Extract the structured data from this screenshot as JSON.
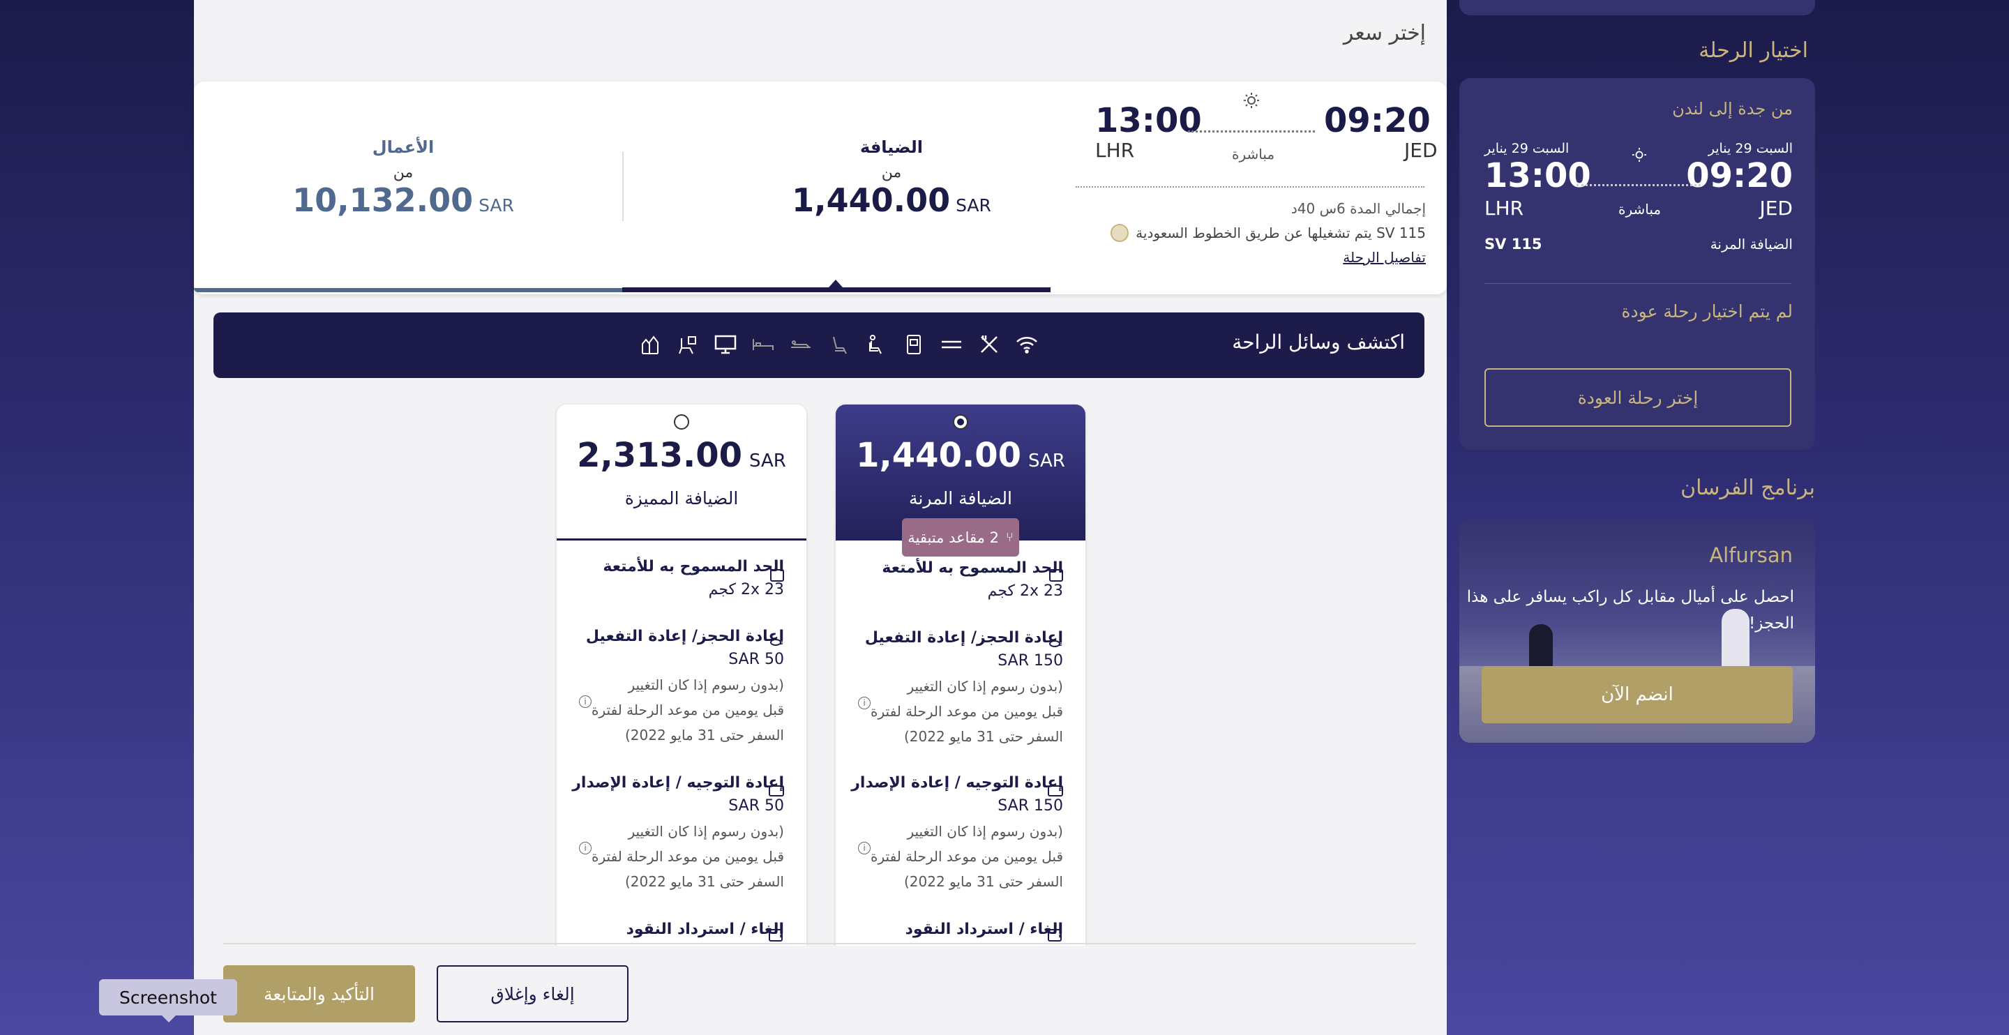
{
  "page": {
    "select_fare_title": "إختر سعر"
  },
  "flight_card": {
    "depart_time": "09:20",
    "arrive_time": "13:00",
    "depart_airport": "JED",
    "arrive_airport": "LHR",
    "stops": "مباشرة",
    "total_duration": "إجمالي المدة 6س 40د",
    "operated_by": "SV 115 يتم تشغيلها عن طريق الخطوط السعودية",
    "details_link": "تفاصيل الرحلة",
    "cabins": [
      {
        "name": "الضيافة",
        "from": "من",
        "price": "1,440.00",
        "currency": "SAR"
      },
      {
        "name": "الأعمال",
        "from": "من",
        "price": "10,132.00",
        "currency": "SAR"
      }
    ]
  },
  "amenities": {
    "title": "اكتشف وسائل الراحة"
  },
  "fares": [
    {
      "price": "1,440.00",
      "currency": "SAR",
      "name": "الضيافة المرنة",
      "selected": true,
      "seats_left": "2 مقاعد متبقية",
      "baggage_title": "الحد المسموح به للأمتعة",
      "baggage_value": "2x 23 كجم",
      "rebook_title": "إعادة الحجز/ إعادة التفعيل",
      "rebook_value": "SAR 150",
      "rebook_note_1": "(بدون رسوم إذا كان التغيير",
      "rebook_note_2": "قبل يومين من موعد الرحلة لفترة",
      "rebook_note_3": "السفر حتى 31 مايو 2022)",
      "reroute_title": "إعادة التوجيه / إعادة الإصدار",
      "reroute_value": "SAR 150",
      "reroute_note_1": "(بدون رسوم إذا كان التغيير",
      "reroute_note_2": "قبل يومين من موعد الرحلة لفترة",
      "reroute_note_3": "السفر حتى 31 مايو 2022)",
      "cancel_title": "إلغاء / استرداد النقود"
    },
    {
      "price": "2,313.00",
      "currency": "SAR",
      "name": "الضيافة المميزة",
      "selected": false,
      "baggage_title": "الحد المسموح به للأمتعة",
      "baggage_value": "2x 23 كجم",
      "rebook_title": "إعادة الحجز/ إعادة التفعيل",
      "rebook_value": "SAR 50",
      "rebook_note_1": "(بدون رسوم إذا كان التغيير",
      "rebook_note_2": "قبل يومين من موعد الرحلة لفترة",
      "rebook_note_3": "السفر حتى 31 مايو 2022)",
      "reroute_title": "إعادة التوجيه / إعادة الإصدار",
      "reroute_value": "SAR 50",
      "reroute_note_1": "(بدون رسوم إذا كان التغيير",
      "reroute_note_2": "قبل يومين من موعد الرحلة لفترة",
      "reroute_note_3": "السفر حتى 31 مايو 2022)",
      "cancel_title": "إلغاء / استرداد النقود"
    }
  ],
  "actions": {
    "confirm": "التأكيد والمتابعة",
    "cancel": "إلغاء وإغلاق"
  },
  "sidebar": {
    "trip_heading": "اختيار الرحلة",
    "route": "من جدة إلى لندن",
    "depart_date": "السبت 29 يناير",
    "arrive_date": "السبت 29 يناير",
    "depart_time": "09:20",
    "arrive_time": "13:00",
    "depart_airport": "JED",
    "arrive_airport": "LHR",
    "stops": "مباشرة",
    "cabin": "الضيافة المرنة",
    "flight_no": "SV 115",
    "no_return": "لم يتم اختيار رحلة عودة",
    "choose_return": "إختر رحلة العودة",
    "loyalty_heading": "برنامج الفرسان",
    "alfursan_title": "Alfursan",
    "alfursan_text_1": "احصل على أميال مقابل كل راكب يسافر على هذا",
    "alfursan_text_2": "الحجز!",
    "join_now": "انضم الآن"
  },
  "tooltip": {
    "label": "Screenshot"
  }
}
